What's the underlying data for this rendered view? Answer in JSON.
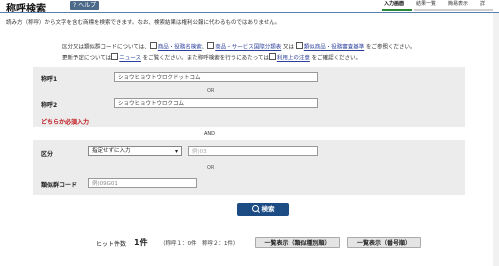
{
  "header": {
    "title": "称呼検索",
    "help_label": "? ヘルプ",
    "steps": [
      "入力画面",
      "結果一覧",
      "簡易表示",
      "詳"
    ]
  },
  "description": "読み方（称呼）から文字を含む商標を検索できます。なお、検索結果は権利公報に代わるものではありません。",
  "notes": {
    "line1_prefix": "区分又は類似群コードについては、",
    "link1": "商品・役務名検索",
    "sep1": "、",
    "link2": "商品・サービス国際分類表",
    "mid": " 又は ",
    "link3": "類似商品・役務審査基準",
    "line1_suffix": " をご参照ください。",
    "line2_prefix": "更新予定については",
    "link4": "ニュース",
    "line2_mid": " をご覧ください。また称呼検索を行うにあたっては",
    "link5": "利用上の注意",
    "line2_suffix": " をご確認ください。"
  },
  "form": {
    "label_shoko1": "称呼1",
    "input_shoko1": "ショウヒョウトウロクドットコム",
    "or1": "OR",
    "label_shoko2": "称呼2",
    "input_shoko2": "ショウヒョウトウロクコム",
    "required": "どちらか必須入力",
    "and": "AND",
    "label_kubun": "区分",
    "select_kubun": "指定せずに入力",
    "kubun_placeholder": "例)03",
    "or2": "OR",
    "label_ruiji": "類似群コード",
    "ruiji_placeholder": "例)09G01"
  },
  "search_button": "検索",
  "results": {
    "hit_label": "ヒット件数",
    "hit_count": "1件",
    "breakdown": "（称呼１：0件　称呼２：1件）",
    "list_button1": "一覧表示（類似種別順）",
    "list_button2": "一覧表示（番号順）"
  },
  "colors": {
    "accent": "#1d4c85",
    "panel": "#ececec",
    "required": "#c0151b"
  }
}
